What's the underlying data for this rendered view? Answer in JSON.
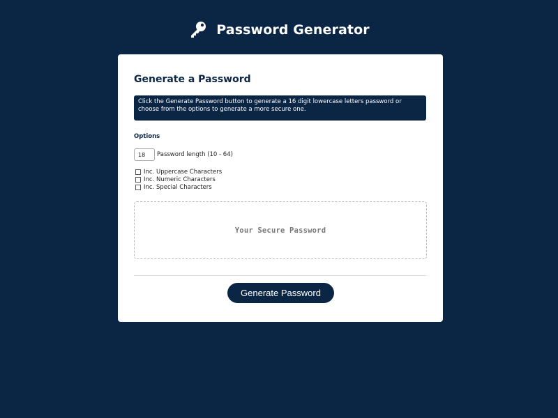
{
  "header": {
    "icon": "key-icon",
    "title": "Password Generator"
  },
  "card": {
    "title": "Generate a Password",
    "info": "Click the Generate Password button to generate a 16 digit lowercase letters password or choose from the options to generate a more secure one.",
    "options_heading": "Options",
    "length": {
      "value": "18",
      "label": "Password length (10 - 64)"
    },
    "checkboxes": [
      {
        "label": "Inc. Uppercase Characters",
        "checked": false
      },
      {
        "label": "Inc. Numeric Characters",
        "checked": false
      },
      {
        "label": "Inc. Special Characters",
        "checked": false
      }
    ],
    "password_placeholder": "Your Secure Password",
    "generate_button": "Generate Password"
  },
  "colors": {
    "background": "#0b2545",
    "card": "#ffffff",
    "accent": "#0b2545"
  }
}
